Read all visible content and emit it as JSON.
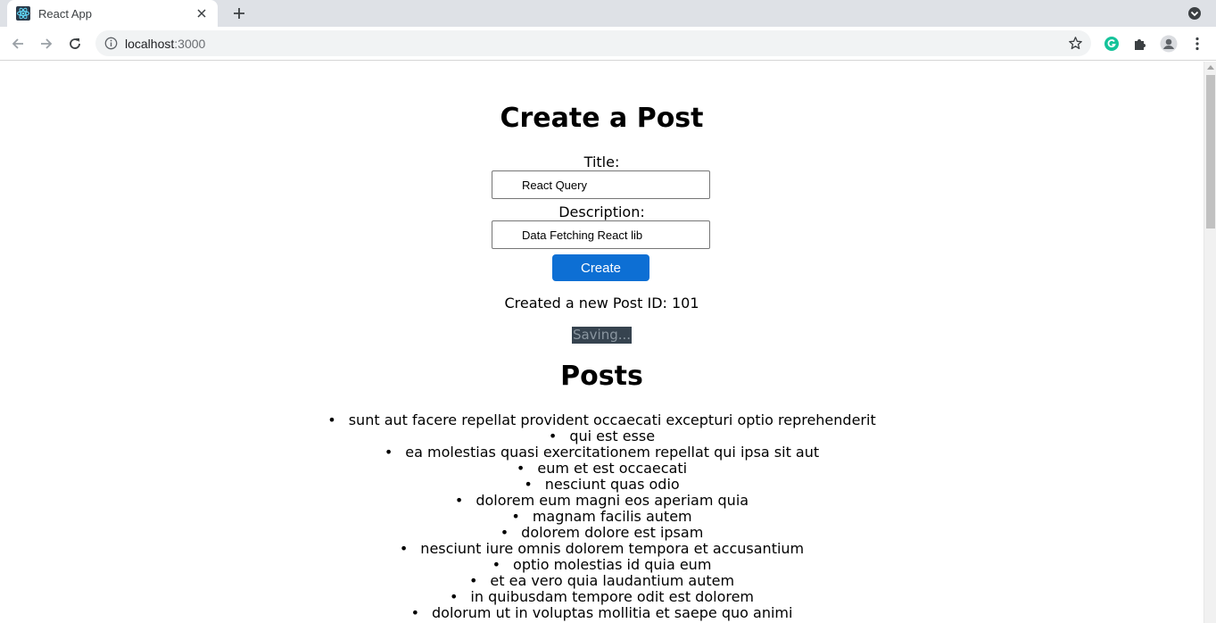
{
  "browser": {
    "tab_title": "React App",
    "url_host": "localhost",
    "url_port": ":3000"
  },
  "page": {
    "heading": "Create a Post",
    "title_label": "Title:",
    "title_value": "React Query",
    "description_label": "Description:",
    "description_value": "Data Fetching React lib",
    "create_button": "Create",
    "created_message": "Created a new Post ID: 101",
    "saving_text": "Saving...",
    "posts_heading": "Posts",
    "posts": [
      "sunt aut facere repellat provident occaecati excepturi optio reprehenderit",
      "qui est esse",
      "ea molestias quasi exercitationem repellat qui ipsa sit aut",
      "eum et est occaecati",
      "nesciunt quas odio",
      "dolorem eum magni eos aperiam quia",
      "magnam facilis autem",
      "dolorem dolore est ipsam",
      "nesciunt iure omnis dolorem tempora et accusantium",
      "optio molestias id quia eum",
      "et ea vero quia laudantium autem",
      "in quibusdam tempore odit est dolorem",
      "dolorum ut in voluptas mollitia et saepe quo animi"
    ]
  },
  "colors": {
    "button": "#0d6fd4",
    "saving_bg": "#36434f"
  },
  "icons": [
    "react-favicon-icon",
    "close-icon",
    "plus-icon",
    "tab-search-icon",
    "back-icon",
    "forward-icon",
    "reload-icon",
    "info-icon",
    "star-icon",
    "grammarly-icon",
    "extensions-icon",
    "profile-icon",
    "menu-icon"
  ]
}
